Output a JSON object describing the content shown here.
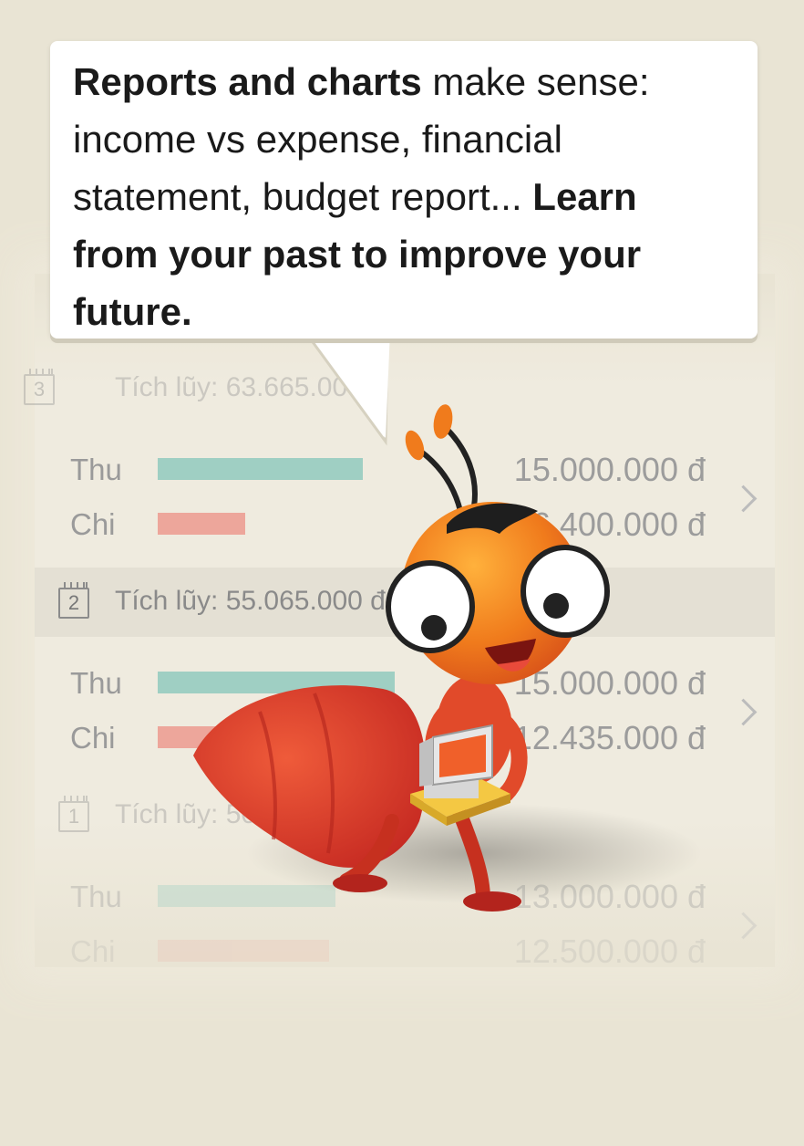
{
  "tooltip": {
    "bold1": "Reports and charts",
    "text1": " make sense: income vs expense, financial statement, budget report... ",
    "bold2": "Learn from your past to improve your future."
  },
  "months": [
    {
      "number": "3",
      "label": "Tích lũy: 63.665.000 đ",
      "income_label": "Thu",
      "income_amount": "15.000.000 đ",
      "income_fraction": 0.69,
      "expense_label": "Chi",
      "expense_amount": "6.400.000 đ",
      "expense_fraction": 0.3
    },
    {
      "number": "2",
      "label": "Tích lũy: 55.065.000 đ",
      "income_label": "Thu",
      "income_amount": "15.000.000 đ",
      "income_fraction": 0.8,
      "expense_label": "Chi",
      "expense_amount": "12.435.000 đ",
      "expense_fraction": 0.65
    },
    {
      "number": "1",
      "label": "Tích lũy: 50.",
      "income_label": "Thu",
      "income_amount": "13.000.000 đ",
      "income_fraction": 0.6,
      "expense_label": "Chi",
      "expense_amount": "12.500.000 đ",
      "expense_fraction": 0.59
    }
  ],
  "colors": {
    "background": "#e9e4d4",
    "income_bar": "#9fcfc3",
    "expense_bar": "#eda69b",
    "ant_orange": "#f07b1c",
    "ant_red": "#d9362a"
  }
}
